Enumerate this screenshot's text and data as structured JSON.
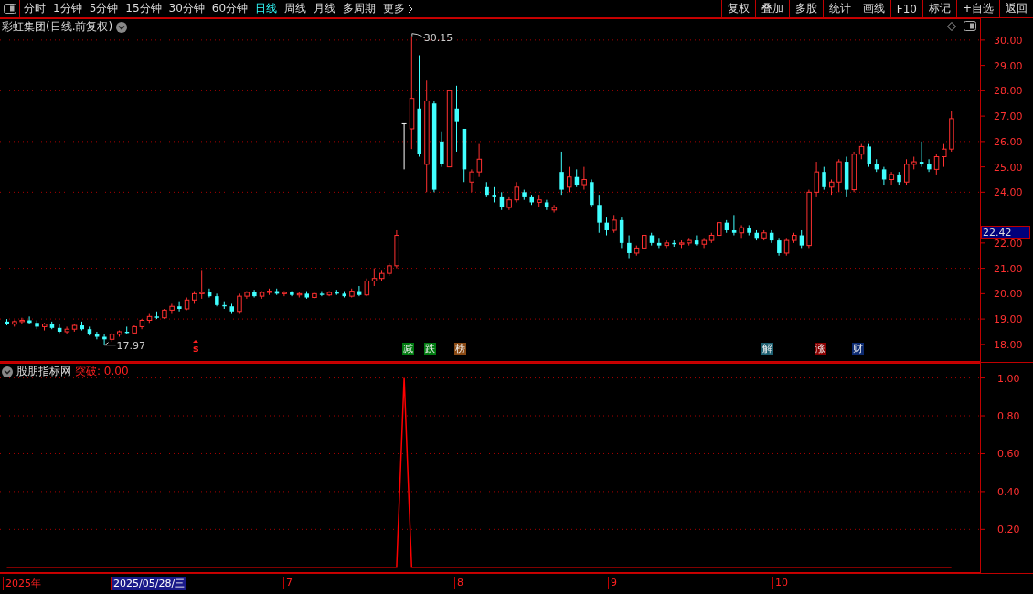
{
  "toolbar": {
    "periods": [
      {
        "label": "分时",
        "selected": false
      },
      {
        "label": "1分钟",
        "selected": false
      },
      {
        "label": "5分钟",
        "selected": false
      },
      {
        "label": "15分钟",
        "selected": false
      },
      {
        "label": "30分钟",
        "selected": false
      },
      {
        "label": "60分钟",
        "selected": false
      },
      {
        "label": "日线",
        "selected": true
      },
      {
        "label": "周线",
        "selected": false
      },
      {
        "label": "月线",
        "selected": false
      },
      {
        "label": "多周期",
        "selected": false
      },
      {
        "label": "更多",
        "selected": false
      }
    ],
    "actions": [
      "复权",
      "叠加",
      "多股",
      "统计",
      "画线",
      "F10",
      "标记",
      "+自选",
      "返回"
    ]
  },
  "price_chart": {
    "title": "彩虹集团(日线.前复权)",
    "current_price": "22.42",
    "high_label": "30.15",
    "low_label": "17.97",
    "markers": [
      {
        "text": "s",
        "kind": "plain",
        "color": "#ff2020"
      },
      {
        "text": "减",
        "kind": "tag",
        "color": "#007a10"
      },
      {
        "text": "跌",
        "kind": "tag",
        "color": "#007a10"
      },
      {
        "text": "榜",
        "kind": "tag",
        "color": "#8a4a14"
      },
      {
        "text": "解",
        "kind": "tag",
        "color": "#1c5f70"
      },
      {
        "text": "涨",
        "kind": "tag",
        "color": "#8a0000"
      },
      {
        "text": "财",
        "kind": "tag",
        "color": "#0c2a70"
      }
    ],
    "chart_data": {
      "type": "candlestick",
      "grid": true,
      "ylim": [
        17.31,
        30.86
      ],
      "yticks": [
        {
          "value": 30,
          "label": "30.00"
        },
        {
          "value": 29,
          "label": "29.00"
        },
        {
          "value": 28,
          "label": "28.00"
        },
        {
          "value": 27,
          "label": "27.00"
        },
        {
          "value": 26,
          "label": "26.00"
        },
        {
          "value": 25,
          "label": "25.00"
        },
        {
          "value": 24,
          "label": "24.00"
        },
        {
          "value": 22,
          "label": "22.00"
        },
        {
          "value": 21,
          "label": "21.00"
        },
        {
          "value": 20,
          "label": "20.00"
        },
        {
          "value": 19,
          "label": "19.00"
        },
        {
          "value": 18,
          "label": "18.00"
        }
      ],
      "ohlc": [
        [
          18.9,
          19.0,
          18.75,
          18.8
        ],
        [
          18.8,
          18.95,
          18.7,
          18.9
        ],
        [
          18.9,
          19.05,
          18.8,
          18.95
        ],
        [
          18.95,
          19.1,
          18.8,
          18.85
        ],
        [
          18.85,
          18.95,
          18.6,
          18.7
        ],
        [
          18.7,
          18.85,
          18.55,
          18.8
        ],
        [
          18.8,
          18.9,
          18.6,
          18.65
        ],
        [
          18.65,
          18.8,
          18.45,
          18.5
        ],
        [
          18.5,
          18.7,
          18.4,
          18.6
        ],
        [
          18.6,
          18.8,
          18.5,
          18.75
        ],
        [
          18.75,
          18.9,
          18.55,
          18.6
        ],
        [
          18.6,
          18.7,
          18.35,
          18.4
        ],
        [
          18.4,
          18.5,
          18.2,
          18.3
        ],
        [
          18.3,
          18.4,
          17.97,
          18.2
        ],
        [
          18.2,
          18.45,
          18.1,
          18.4
        ],
        [
          18.4,
          18.55,
          18.3,
          18.5
        ],
        [
          18.5,
          18.7,
          18.4,
          18.45
        ],
        [
          18.45,
          18.75,
          18.4,
          18.7
        ],
        [
          18.7,
          19.0,
          18.6,
          18.95
        ],
        [
          18.95,
          19.2,
          18.85,
          19.1
        ],
        [
          19.1,
          19.3,
          19.0,
          19.05
        ],
        [
          19.05,
          19.4,
          19.0,
          19.35
        ],
        [
          19.35,
          19.6,
          19.2,
          19.5
        ],
        [
          19.5,
          19.7,
          19.3,
          19.4
        ],
        [
          19.4,
          19.85,
          19.35,
          19.75
        ],
        [
          19.75,
          20.1,
          19.6,
          20.0
        ],
        [
          20.0,
          20.9,
          19.8,
          20.05
        ],
        [
          20.05,
          20.2,
          19.85,
          19.9
        ],
        [
          19.9,
          20.0,
          19.5,
          19.55
        ],
        [
          19.55,
          19.7,
          19.4,
          19.5
        ],
        [
          19.5,
          19.6,
          19.2,
          19.3
        ],
        [
          19.3,
          20.0,
          19.2,
          19.9
        ],
        [
          19.9,
          20.1,
          19.8,
          20.05
        ],
        [
          20.05,
          20.15,
          19.85,
          19.9
        ],
        [
          19.9,
          20.1,
          19.8,
          20.05
        ],
        [
          20.05,
          20.2,
          19.95,
          20.1
        ],
        [
          20.1,
          20.2,
          19.95,
          20.0
        ],
        [
          20.0,
          20.1,
          19.9,
          20.05
        ],
        [
          20.05,
          20.1,
          19.9,
          19.95
        ],
        [
          19.95,
          20.05,
          19.85,
          20.0
        ],
        [
          20.0,
          20.1,
          19.8,
          19.85
        ],
        [
          19.85,
          20.05,
          19.8,
          20.0
        ],
        [
          20.0,
          20.1,
          19.9,
          19.95
        ],
        [
          19.95,
          20.1,
          19.9,
          20.05
        ],
        [
          20.05,
          20.15,
          19.95,
          20.0
        ],
        [
          20.0,
          20.1,
          19.85,
          19.9
        ],
        [
          19.9,
          20.2,
          19.85,
          20.1
        ],
        [
          20.1,
          20.3,
          19.9,
          19.95
        ],
        [
          19.95,
          20.6,
          19.9,
          20.5
        ],
        [
          20.5,
          21.0,
          20.3,
          20.6
        ],
        [
          20.6,
          20.9,
          20.5,
          20.8
        ],
        [
          20.8,
          21.2,
          20.7,
          21.1
        ],
        [
          21.1,
          22.5,
          21.0,
          22.3
        ],
        [
          26.7,
          26.7,
          24.9,
          26.7
        ],
        [
          26.5,
          30.15,
          25.7,
          27.7
        ],
        [
          27.3,
          29.4,
          25.4,
          25.5
        ],
        [
          25.1,
          28.4,
          24.0,
          27.6
        ],
        [
          27.5,
          27.6,
          24.0,
          24.1
        ],
        [
          26.0,
          26.4,
          25.0,
          25.1
        ],
        [
          25.0,
          28.0,
          25.0,
          28.0
        ],
        [
          27.3,
          28.2,
          25.6,
          26.8
        ],
        [
          26.5,
          26.5,
          24.4,
          24.9
        ],
        [
          24.4,
          24.9,
          24.0,
          24.8
        ],
        [
          24.8,
          25.9,
          24.6,
          25.3
        ],
        [
          24.2,
          24.4,
          23.8,
          23.9
        ],
        [
          23.9,
          24.2,
          23.6,
          23.8
        ],
        [
          23.8,
          24.0,
          23.3,
          23.4
        ],
        [
          23.4,
          23.8,
          23.3,
          23.7
        ],
        [
          23.7,
          24.4,
          23.6,
          24.2
        ],
        [
          24.0,
          24.1,
          23.7,
          23.8
        ],
        [
          23.8,
          23.9,
          23.5,
          23.6
        ],
        [
          23.6,
          23.9,
          23.4,
          23.7
        ],
        [
          23.6,
          23.7,
          23.3,
          23.4
        ],
        [
          23.3,
          23.5,
          23.2,
          23.4
        ],
        [
          24.8,
          25.6,
          23.9,
          24.1
        ],
        [
          24.2,
          25.0,
          24.0,
          24.6
        ],
        [
          24.6,
          24.9,
          24.2,
          24.3
        ],
        [
          24.3,
          25.0,
          24.1,
          24.5
        ],
        [
          24.4,
          24.5,
          23.4,
          23.5
        ],
        [
          23.5,
          23.9,
          22.4,
          22.8
        ],
        [
          22.8,
          23.0,
          22.3,
          22.5
        ],
        [
          22.5,
          23.1,
          22.4,
          22.9
        ],
        [
          22.9,
          23.0,
          21.8,
          22.0
        ],
        [
          22.0,
          22.3,
          21.4,
          21.6
        ],
        [
          21.6,
          21.9,
          21.5,
          21.8
        ],
        [
          21.8,
          22.4,
          21.7,
          22.3
        ],
        [
          22.3,
          22.4,
          21.9,
          22.0
        ],
        [
          22.0,
          22.2,
          21.8,
          21.9
        ],
        [
          21.9,
          22.1,
          21.8,
          22.0
        ],
        [
          22.0,
          22.1,
          21.85,
          21.95
        ],
        [
          21.95,
          22.1,
          21.8,
          22.0
        ],
        [
          22.0,
          22.2,
          21.9,
          22.1
        ],
        [
          22.1,
          22.3,
          21.9,
          21.95
        ],
        [
          21.95,
          22.2,
          21.8,
          22.1
        ],
        [
          22.1,
          22.4,
          22.0,
          22.3
        ],
        [
          22.3,
          23.0,
          22.2,
          22.8
        ],
        [
          22.8,
          22.9,
          22.4,
          22.5
        ],
        [
          22.5,
          23.1,
          22.3,
          22.4
        ],
        [
          22.4,
          22.7,
          22.2,
          22.6
        ],
        [
          22.6,
          22.7,
          22.3,
          22.4
        ],
        [
          22.4,
          22.5,
          22.1,
          22.2
        ],
        [
          22.2,
          22.5,
          22.1,
          22.4
        ],
        [
          22.4,
          22.5,
          22.0,
          22.1
        ],
        [
          22.1,
          22.2,
          21.5,
          21.6
        ],
        [
          21.6,
          22.2,
          21.5,
          22.1
        ],
        [
          22.1,
          22.4,
          22.0,
          22.3
        ],
        [
          22.3,
          22.5,
          21.8,
          21.9
        ],
        [
          21.9,
          24.1,
          21.8,
          24.0
        ],
        [
          24.0,
          25.2,
          23.8,
          24.8
        ],
        [
          24.8,
          25.0,
          24.1,
          24.2
        ],
        [
          24.2,
          24.5,
          23.9,
          24.4
        ],
        [
          24.4,
          25.3,
          24.0,
          25.2
        ],
        [
          25.2,
          25.4,
          23.8,
          24.1
        ],
        [
          24.1,
          25.6,
          24.0,
          25.5
        ],
        [
          25.5,
          25.9,
          25.3,
          25.8
        ],
        [
          25.8,
          25.9,
          25.0,
          25.1
        ],
        [
          25.1,
          25.3,
          24.8,
          24.9
        ],
        [
          24.9,
          25.0,
          24.3,
          24.5
        ],
        [
          24.5,
          24.8,
          24.3,
          24.7
        ],
        [
          24.7,
          24.8,
          24.3,
          24.4
        ],
        [
          24.4,
          25.3,
          24.3,
          25.1
        ],
        [
          25.1,
          25.4,
          24.9,
          25.2
        ],
        [
          25.2,
          26.0,
          25.0,
          25.1
        ],
        [
          25.1,
          25.3,
          24.8,
          24.9
        ],
        [
          24.9,
          25.5,
          24.7,
          25.4
        ],
        [
          25.4,
          25.9,
          25.0,
          25.7
        ],
        [
          25.7,
          27.2,
          25.6,
          26.9
        ]
      ]
    }
  },
  "indicator": {
    "name": "股朋指标网",
    "reading": "突破: 0.00",
    "chart_data": {
      "type": "line",
      "grid": true,
      "ylim": [
        -0.03,
        1.08
      ],
      "yticks": [
        {
          "value": 0.2,
          "label": "0.20"
        },
        {
          "value": 0.4,
          "label": "0.40"
        },
        {
          "value": 0.6,
          "label": "0.60"
        },
        {
          "value": 0.8,
          "label": "0.80"
        },
        {
          "value": 1.0,
          "label": "1.00"
        }
      ],
      "series": [
        {
          "color": "#ff0000",
          "values": [
            0,
            0,
            0,
            0,
            0,
            0,
            0,
            0,
            0,
            0,
            0,
            0,
            0,
            0,
            0,
            0,
            0,
            0,
            0,
            0,
            0,
            0,
            0,
            0,
            0,
            0,
            0,
            0,
            0,
            0,
            0,
            0,
            0,
            0,
            0,
            0,
            0,
            0,
            0,
            0,
            0,
            0,
            0,
            0,
            0,
            0,
            0,
            0,
            0,
            0,
            0,
            0,
            0,
            1,
            0,
            0,
            0,
            0,
            0,
            0,
            0,
            0,
            0,
            0,
            0,
            0,
            0,
            0,
            0,
            0,
            0,
            0,
            0,
            0,
            0,
            0,
            0,
            0,
            0,
            0,
            0,
            0,
            0,
            0,
            0,
            0,
            0,
            0,
            0,
            0,
            0,
            0,
            0,
            0,
            0,
            0,
            0,
            0,
            0,
            0,
            0,
            0,
            0,
            0,
            0,
            0,
            0,
            0,
            0,
            0,
            0,
            0,
            0,
            0,
            0,
            0,
            0,
            0,
            0,
            0,
            0,
            0,
            0,
            0,
            0,
            0,
            0
          ]
        }
      ]
    }
  },
  "time_axis": {
    "labels": [
      {
        "text": "2025年",
        "selected": false
      },
      {
        "text": "2025/05/28/三",
        "selected": true
      },
      {
        "text": "7",
        "selected": false
      },
      {
        "text": "8",
        "selected": false
      },
      {
        "text": "9",
        "selected": false
      },
      {
        "text": "10",
        "selected": false
      }
    ]
  }
}
